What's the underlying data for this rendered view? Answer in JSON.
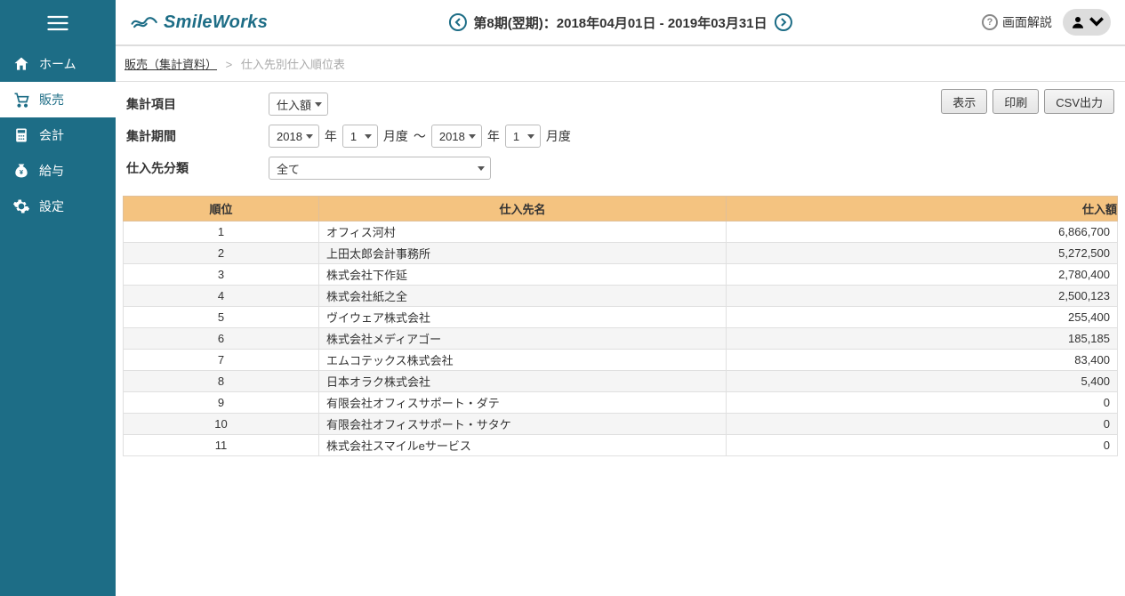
{
  "brand": "SmileWorks",
  "sidebar": {
    "items": [
      {
        "label": "ホーム"
      },
      {
        "label": "販売"
      },
      {
        "label": "会計"
      },
      {
        "label": "給与"
      },
      {
        "label": "設定"
      }
    ]
  },
  "period_title": "第8期(翌期)：2018年04月01日 - 2019年03月31日",
  "help_label": "画面解説",
  "breadcrumb": {
    "parent": "販売（集計資料）",
    "sep": ">",
    "current": "仕入先別仕入順位表"
  },
  "filters": {
    "item_label": "集計項目",
    "item_value": "仕入額",
    "period_label": "集計期間",
    "from_year": "2018",
    "from_month": "1",
    "to_year": "2018",
    "to_month": "1",
    "year_suffix": "年",
    "month_suffix": "月度",
    "tilde": "〜",
    "category_label": "仕入先分類",
    "category_value": "全て"
  },
  "buttons": {
    "show": "表示",
    "print": "印刷",
    "csv": "CSV出力"
  },
  "table": {
    "headers": {
      "rank": "順位",
      "supplier": "仕入先名",
      "amount": "仕入額"
    },
    "rows": [
      {
        "rank": "1",
        "supplier": "オフィス河村",
        "amount": "6,866,700"
      },
      {
        "rank": "2",
        "supplier": "上田太郎会計事務所",
        "amount": "5,272,500"
      },
      {
        "rank": "3",
        "supplier": "株式会社下作延",
        "amount": "2,780,400"
      },
      {
        "rank": "4",
        "supplier": "株式会社紙之全",
        "amount": "2,500,123"
      },
      {
        "rank": "5",
        "supplier": "ヴイウェア株式会社",
        "amount": "255,400"
      },
      {
        "rank": "6",
        "supplier": "株式会社メディアゴー",
        "amount": "185,185"
      },
      {
        "rank": "7",
        "supplier": "エムコテックス株式会社",
        "amount": "83,400"
      },
      {
        "rank": "8",
        "supplier": "日本オラク株式会社",
        "amount": "5,400"
      },
      {
        "rank": "9",
        "supplier": "有限会社オフィスサポート・ダテ",
        "amount": "0"
      },
      {
        "rank": "10",
        "supplier": "有限会社オフィスサポート・サタケ",
        "amount": "0"
      },
      {
        "rank": "11",
        "supplier": "株式会社スマイルeサービス",
        "amount": "0"
      }
    ]
  }
}
